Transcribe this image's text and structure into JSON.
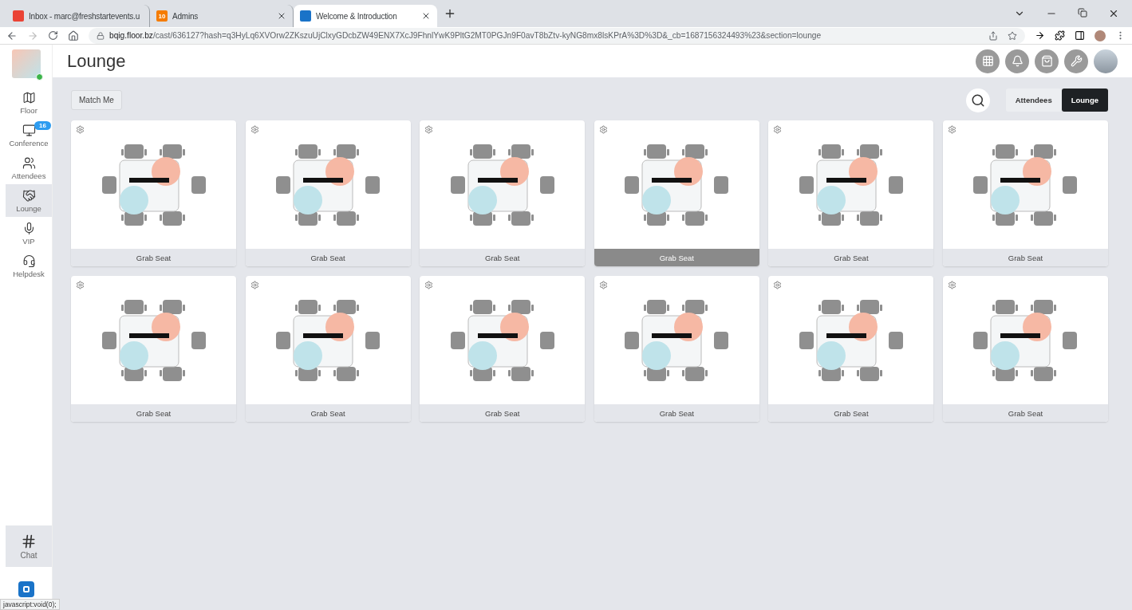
{
  "browser": {
    "tabs": [
      {
        "kind": "mail",
        "title": "Inbox - marc@freshstartevents.u",
        "selected": false
      },
      {
        "kind": "badge",
        "badge": "10",
        "title": "Admins",
        "selected": false
      },
      {
        "kind": "app",
        "title": "Welcome & Introduction",
        "selected": true
      }
    ],
    "url_domain": "bqig.floor.bz",
    "url_path": "/cast/636127?hash=q3HyLq6XVOrw2ZKszuUjClxyGDcbZW49ENX7XcJ9FhnlYwK9PltG2MT0PGJn9F0avT8bZtv-kyNG8mx8lsKPrA%3D%3D&_cb=1687156324493%23&section=lounge"
  },
  "sidebar": {
    "items": [
      {
        "kind": "floor",
        "label": "Floor",
        "selected": false
      },
      {
        "kind": "conference",
        "label": "Conference",
        "badge": "16",
        "selected": false
      },
      {
        "kind": "attendees",
        "label": "Attendees",
        "selected": false
      },
      {
        "kind": "lounge",
        "label": "Lounge",
        "selected": true
      },
      {
        "kind": "vip",
        "label": "VIP",
        "selected": false
      },
      {
        "kind": "helpdesk",
        "label": "Helpdesk",
        "selected": false
      }
    ],
    "chat": {
      "label": "Chat",
      "active": true
    }
  },
  "page": {
    "title": "Lounge",
    "match_button": "Match Me",
    "view_tabs": [
      {
        "label": "Attendees",
        "selected": false
      },
      {
        "label": "Lounge",
        "selected": true
      }
    ]
  },
  "tables": [
    {
      "button": "Grab Seat",
      "highlighted": false
    },
    {
      "button": "Grab Seat",
      "highlighted": false
    },
    {
      "button": "Grab Seat",
      "highlighted": false
    },
    {
      "button": "Grab Seat",
      "highlighted": true
    },
    {
      "button": "Grab Seat",
      "highlighted": false
    },
    {
      "button": "Grab Seat",
      "highlighted": false
    },
    {
      "button": "Grab Seat",
      "highlighted": false
    },
    {
      "button": "Grab Seat",
      "highlighted": false
    },
    {
      "button": "Grab Seat",
      "highlighted": false
    },
    {
      "button": "Grab Seat",
      "highlighted": false
    },
    {
      "button": "Grab Seat",
      "highlighted": false
    },
    {
      "button": "Grab Seat",
      "highlighted": false
    }
  ],
  "status_bar": "javascript:void(0);"
}
